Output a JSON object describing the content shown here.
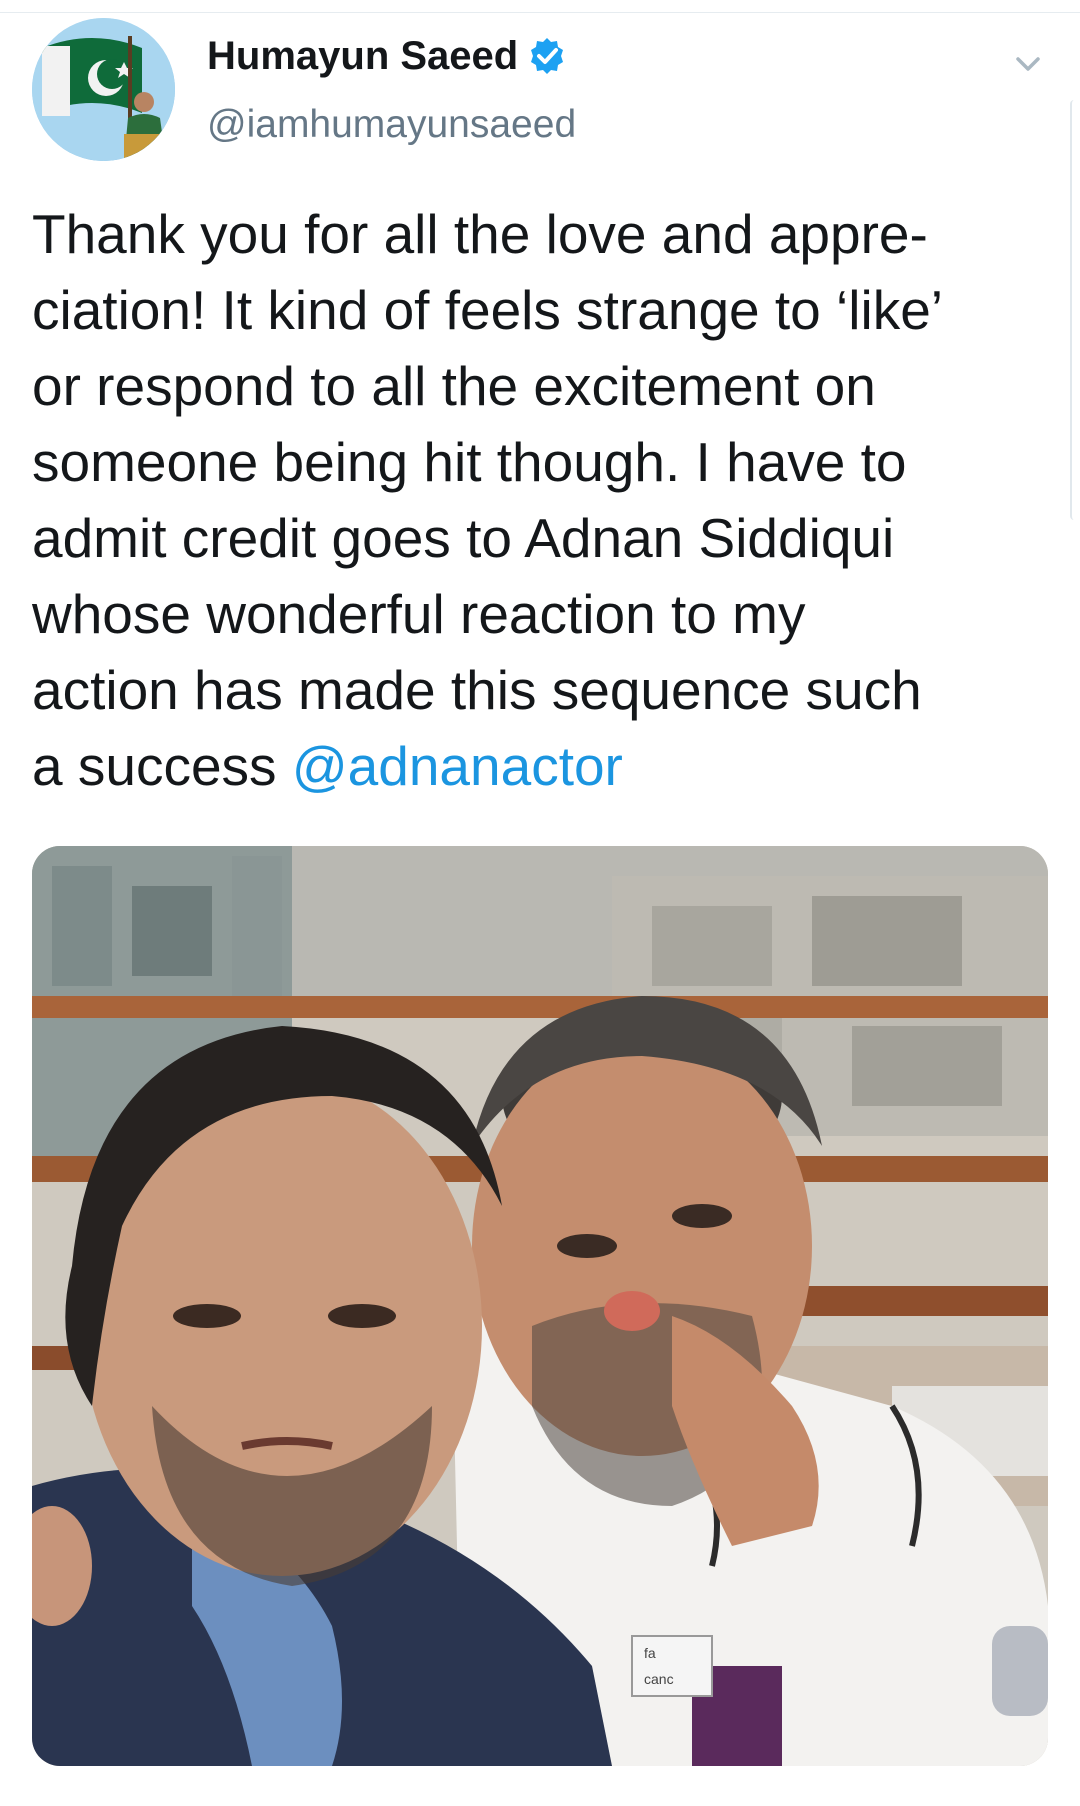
{
  "author": {
    "display_name": "Humayun Saeed",
    "handle": "@iamhumayunsaeed",
    "verified": true,
    "verified_color": "#1da1f2"
  },
  "icons": {
    "avatar": "profile-photo-with-flag",
    "verified": "verified-badge-icon",
    "more": "chevron-down-icon"
  },
  "tweet": {
    "lines": [
      "Thank you for all the love and appre-",
      "ciation! It kind of feels strange to ‘like’",
      "or respond to all the excitement on",
      "someone being hit though. I have to",
      "admit credit goes to Adnan Siddiqui",
      "whose wonderful reaction to my",
      "action has made this sequence such"
    ],
    "last_line_prefix": "a success ",
    "mention": "@adnanactor",
    "mention_color": "#1b95e0"
  },
  "media": {
    "badge_text_1": "fa",
    "badge_text_2": "canc"
  }
}
